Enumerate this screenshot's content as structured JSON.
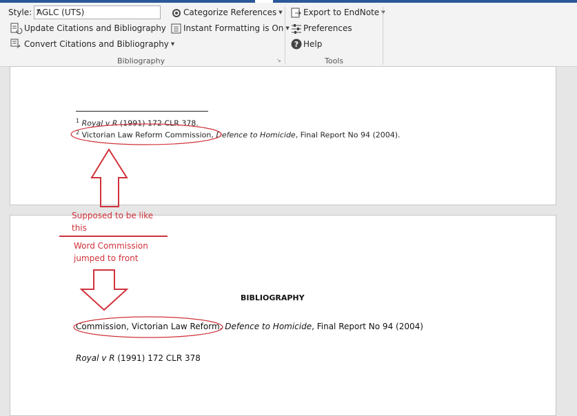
{
  "ribbon": {
    "style_label": "Style:",
    "style_value": "AGLC (UTS)",
    "update_citations": "Update Citations and Bibliography",
    "convert_citations": "Convert Citations and Bibliography",
    "categorize_references": "Categorize References",
    "instant_formatting": "Instant Formatting is On",
    "bibliography_group": "Bibliography",
    "export_endnote": "Export to EndNote",
    "preferences": "Preferences",
    "help": "Help",
    "tools_group": "Tools"
  },
  "page1": {
    "footnote1": {
      "marker": "1",
      "case_name": "Royal v R",
      "citation": " (1991) 172 CLR 378."
    },
    "footnote2": {
      "marker": "2",
      "author": "Victorian Law Reform Commission,",
      "title": "Defence to Homicide",
      "rest": ", Final Report No 94 (2004)."
    }
  },
  "page2": {
    "heading": "BIBLIOGRAPHY",
    "entry1": {
      "author": "Commission, Victorian Law Reform,",
      "title": "Defence to Homicide",
      "rest": ", Final Report No 94 (2004)"
    },
    "entry2": {
      "case_name": "Royal v R",
      "citation": " (1991) 172 CLR 378"
    }
  },
  "annotations": {
    "note1_line1": "Supposed to be like",
    "note1_line2": "this",
    "note2_line1": "Word Commission",
    "note2_line2": "jumped to front"
  },
  "colors": {
    "annotation": "#d0313a",
    "ribbon_accent": "#2b579a"
  }
}
